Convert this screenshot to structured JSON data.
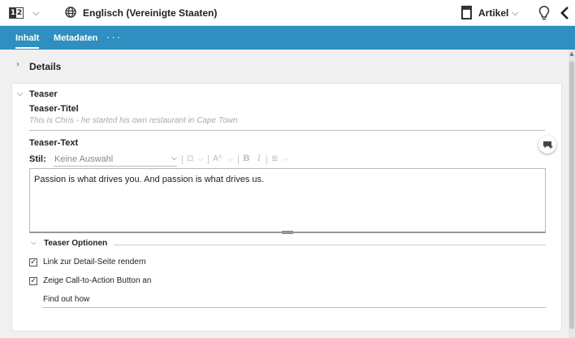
{
  "topbar": {
    "lang_toggle": [
      "1",
      "2"
    ],
    "locale": "Englisch (Vereinigte Staaten)",
    "doc_type": "Artikel"
  },
  "tabs": [
    {
      "label": "Inhalt",
      "active": true
    },
    {
      "label": "Metadaten",
      "active": false
    }
  ],
  "tabs_more": "···",
  "sections": {
    "details": {
      "label": "Details"
    },
    "teaser": {
      "label": "Teaser",
      "title_label": "Teaser-Titel",
      "title_placeholder": "This is Chris - he started his own restaurant in Cape Town",
      "text_label": "Teaser-Text",
      "style_label": "Stil:",
      "style_value": "Keine Auswahl",
      "text_value": "Passion is what drives you. And passion is what drives us.",
      "options": {
        "label": "Teaser Optionen",
        "checkboxes": [
          {
            "label": "Link zur Detail-Seite rendern",
            "checked": true
          },
          {
            "label": "Zeige Call-to-Action Button an",
            "checked": true
          }
        ],
        "cta_value": "Find out how"
      }
    }
  },
  "icons": {
    "check": "☑",
    "toolbar": [
      "insert-box-icon",
      "font-size-icon",
      "bold-icon",
      "italic-icon",
      "align-icon"
    ]
  },
  "colors": {
    "tabbar": "#2e8fc0"
  }
}
